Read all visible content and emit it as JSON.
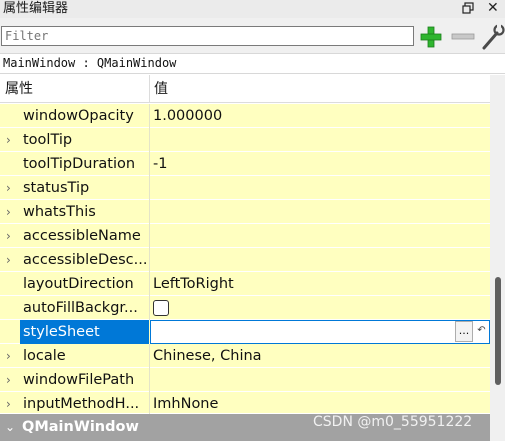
{
  "window": {
    "title": "属性编辑器",
    "close_glyph": "✕"
  },
  "filter": {
    "placeholder": "Filter",
    "value": ""
  },
  "class_label": "MainWindow : QMainWindow",
  "table": {
    "headers": {
      "property": "属性",
      "value": "值"
    },
    "rows": [
      {
        "name": "windowOpacity",
        "value": "1.000000",
        "expandable": false
      },
      {
        "name": "toolTip",
        "value": "",
        "expandable": true
      },
      {
        "name": "toolTipDuration",
        "value": "-1",
        "expandable": false
      },
      {
        "name": "statusTip",
        "value": "",
        "expandable": true
      },
      {
        "name": "whatsThis",
        "value": "",
        "expandable": true
      },
      {
        "name": "accessibleName",
        "value": "",
        "expandable": true
      },
      {
        "name": "accessibleDesc...",
        "value": "",
        "expandable": true
      },
      {
        "name": "layoutDirection",
        "value": "LeftToRight",
        "expandable": false
      },
      {
        "name": "autoFillBackgr...",
        "value": "",
        "checked": false,
        "expandable": false
      },
      {
        "name": "styleSheet",
        "value": "",
        "expandable": false,
        "selected": true,
        "dots_label": "..."
      },
      {
        "name": "locale",
        "value": "Chinese, China",
        "expandable": true
      },
      {
        "name": "windowFilePath",
        "value": "",
        "expandable": true
      },
      {
        "name": "inputMethodH...",
        "value": "ImhNone",
        "expandable": true
      }
    ],
    "group": {
      "name": "QMainWindow"
    }
  },
  "watermark": "CSDN @m0_55951222",
  "colors": {
    "row_background": "#ffffc0",
    "selection": "#0078d7",
    "group_background": "#a2a2a2",
    "add_icon": "#2fb52f"
  },
  "icons": {
    "add": "plus-icon",
    "remove": "minus-icon",
    "configure": "wrench-icon",
    "float": "float-window-icon",
    "close": "close-icon",
    "expand": "chevron-right-icon",
    "collapse": "chevron-down-icon"
  }
}
